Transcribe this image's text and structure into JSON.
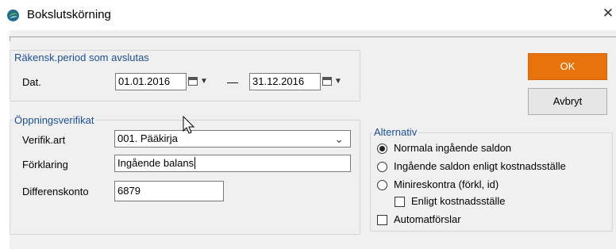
{
  "window": {
    "title": "Bokslutskörning",
    "close_glyph": "✕",
    "icon": "app-logo-icon"
  },
  "period_group": {
    "legend": "Räkensk.period som avslutas",
    "date_label": "Dat.",
    "from_date": "01.01.2016",
    "to_date": "31.12.2016",
    "separator": "—"
  },
  "opening_group": {
    "legend": "Öppningsverifikat",
    "verif_label": "Verifik.art",
    "verif_value": "001. Pääkirja",
    "explain_label": "Förklaring",
    "explain_value": "Ingående balans",
    "diff_label": "Differenskonto",
    "diff_value": "6879"
  },
  "buttons": {
    "ok": "OK",
    "cancel": "Avbryt"
  },
  "options_group": {
    "legend": "Alternativ",
    "radio_normal": "Normala ingående saldon",
    "radio_costcenter": "Ingående saldon enligt kostnadsställe",
    "radio_subledger": "Minireskontra (förkl, id)",
    "check_costcenter": "Enligt kostnadsställe",
    "check_auto": "Automatförslar"
  },
  "colors": {
    "accent": "#e8730c",
    "legend_text": "#1c4f8f"
  }
}
